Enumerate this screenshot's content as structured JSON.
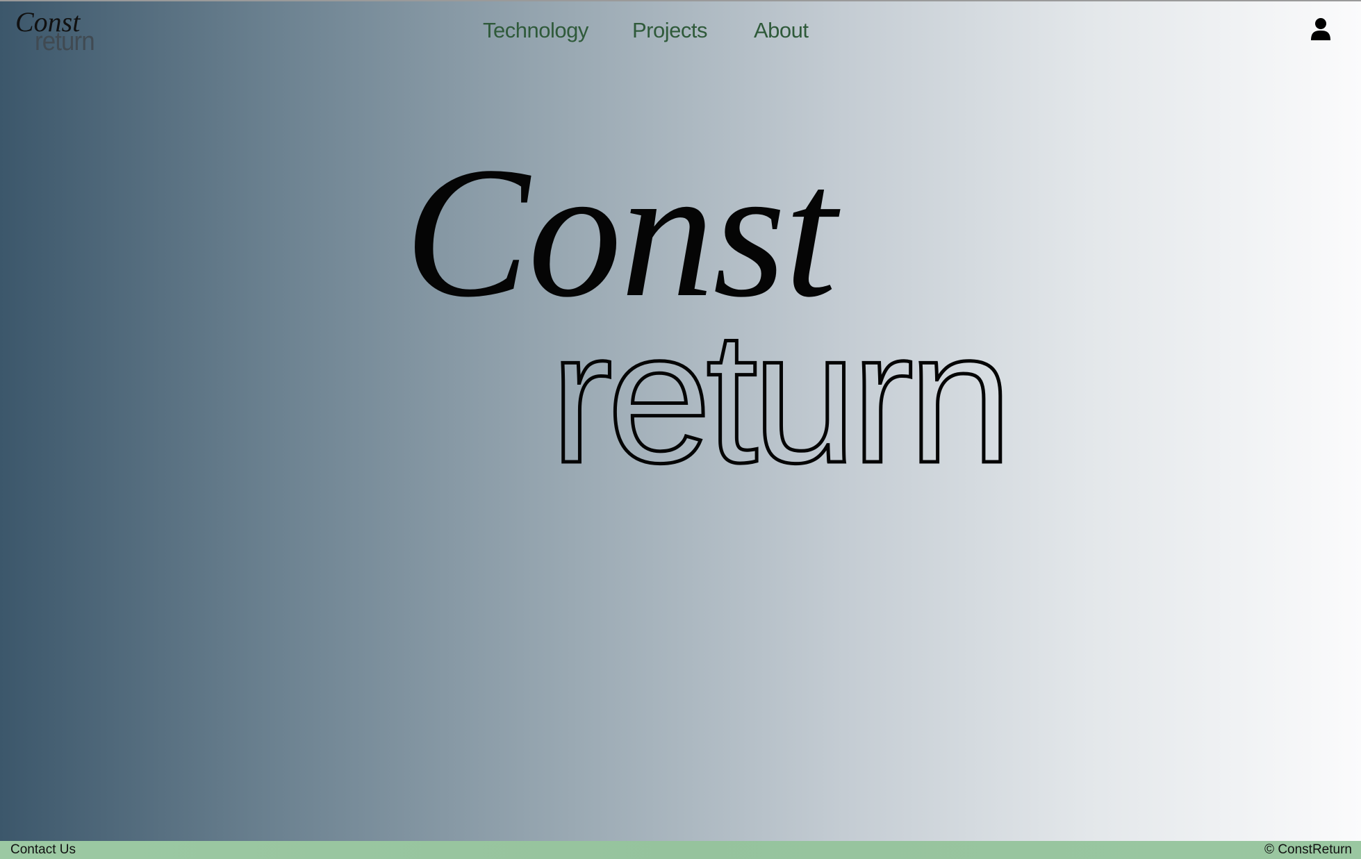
{
  "header": {
    "logo": {
      "line1": "Const",
      "line2": "return"
    },
    "nav": {
      "items": [
        {
          "label": "Technology"
        },
        {
          "label": "Projects"
        },
        {
          "label": "About"
        }
      ]
    },
    "user_icon": "user-icon"
  },
  "hero": {
    "line1": "Const",
    "line2": "return"
  },
  "footer": {
    "contact_label": "Contact Us",
    "copyright": "© ConstReturn"
  },
  "colors": {
    "nav_text": "#2f5a3a",
    "footer_bg": "#9ac7a1",
    "gradient_left": "#3c576b",
    "gradient_right": "#fbfbfc"
  }
}
